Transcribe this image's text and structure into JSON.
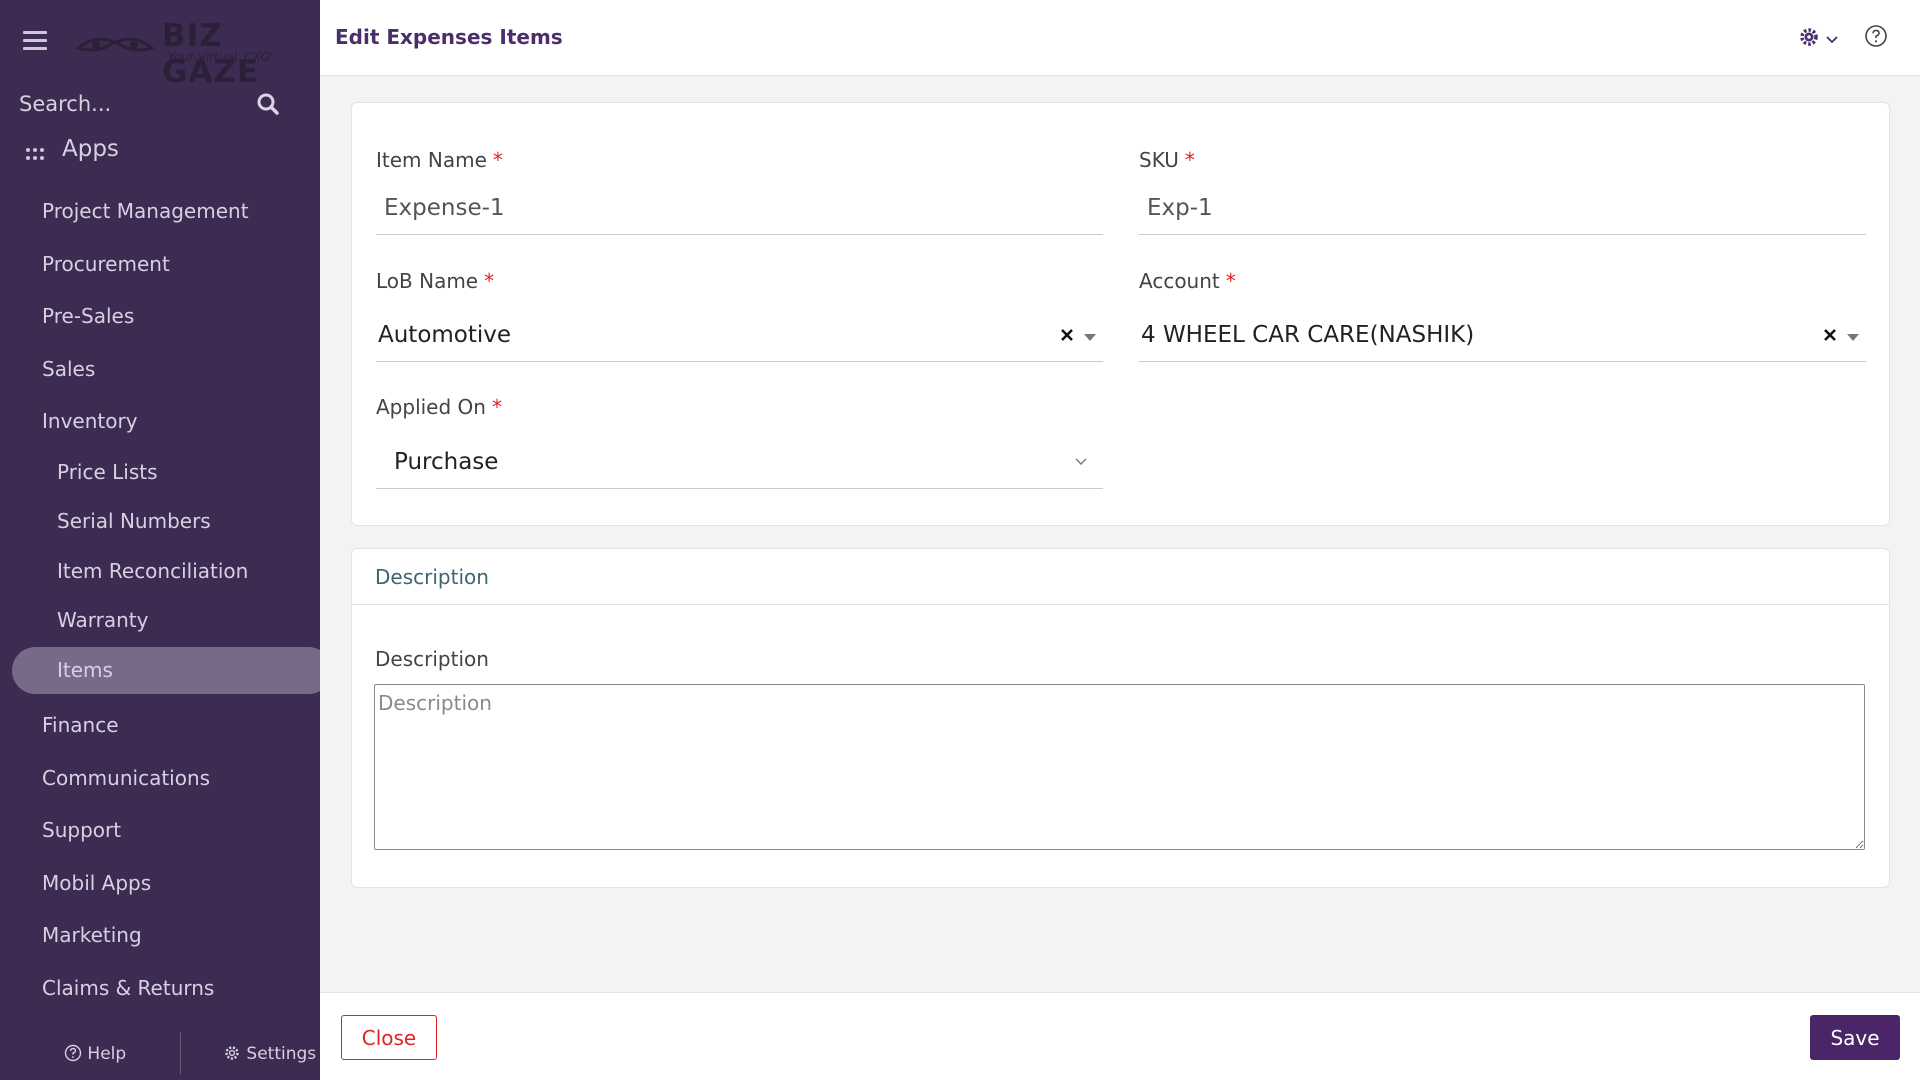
{
  "sidebar": {
    "logo_text": "BIZ GAZE",
    "logo_tagline": "Your Virtual 'CXO'",
    "search_placeholder": "Search...",
    "apps_label": "Apps",
    "nav": [
      {
        "label": "Project Management"
      },
      {
        "label": "Procurement"
      },
      {
        "label": "Pre-Sales"
      },
      {
        "label": "Sales"
      },
      {
        "label": "Inventory"
      },
      {
        "label": "Price Lists"
      },
      {
        "label": "Serial Numbers"
      },
      {
        "label": "Item Reconciliation"
      },
      {
        "label": "Warranty"
      },
      {
        "label": "Items"
      },
      {
        "label": "Finance"
      },
      {
        "label": "Communications"
      },
      {
        "label": "Support"
      },
      {
        "label": "Mobil Apps"
      },
      {
        "label": "Marketing"
      },
      {
        "label": "Claims & Returns"
      }
    ],
    "active_item": "Items",
    "footer": {
      "help_label": "Help",
      "settings_label": "Settings"
    }
  },
  "header": {
    "title": "Edit Expenses Items",
    "icons": [
      "gear-icon",
      "chevron-down-icon",
      "help-circle-icon"
    ]
  },
  "form": {
    "item_name": {
      "label": "Item Name",
      "required_mark": "*",
      "value": "Expense-1"
    },
    "sku": {
      "label": "SKU",
      "required_mark": "*",
      "value": "Exp-1"
    },
    "lob_name": {
      "label": "LoB Name",
      "required_mark": "*",
      "value": "Automotive"
    },
    "account": {
      "label": "Account",
      "required_mark": "*",
      "value": "4 WHEEL CAR CARE(NASHIK)"
    },
    "applied_on": {
      "label": "Applied On",
      "required_mark": "*",
      "value": "Purchase"
    }
  },
  "description_section": {
    "title": "Description",
    "field_label": "Description",
    "placeholder": "Description"
  },
  "actions": {
    "close_label": "Close",
    "save_label": "Save"
  },
  "colors": {
    "sidebar_bg": "#3d2b52",
    "accent": "#4a2668",
    "title": "#4a2f6a",
    "required": "#e02424",
    "active_nav": "#776a89"
  }
}
